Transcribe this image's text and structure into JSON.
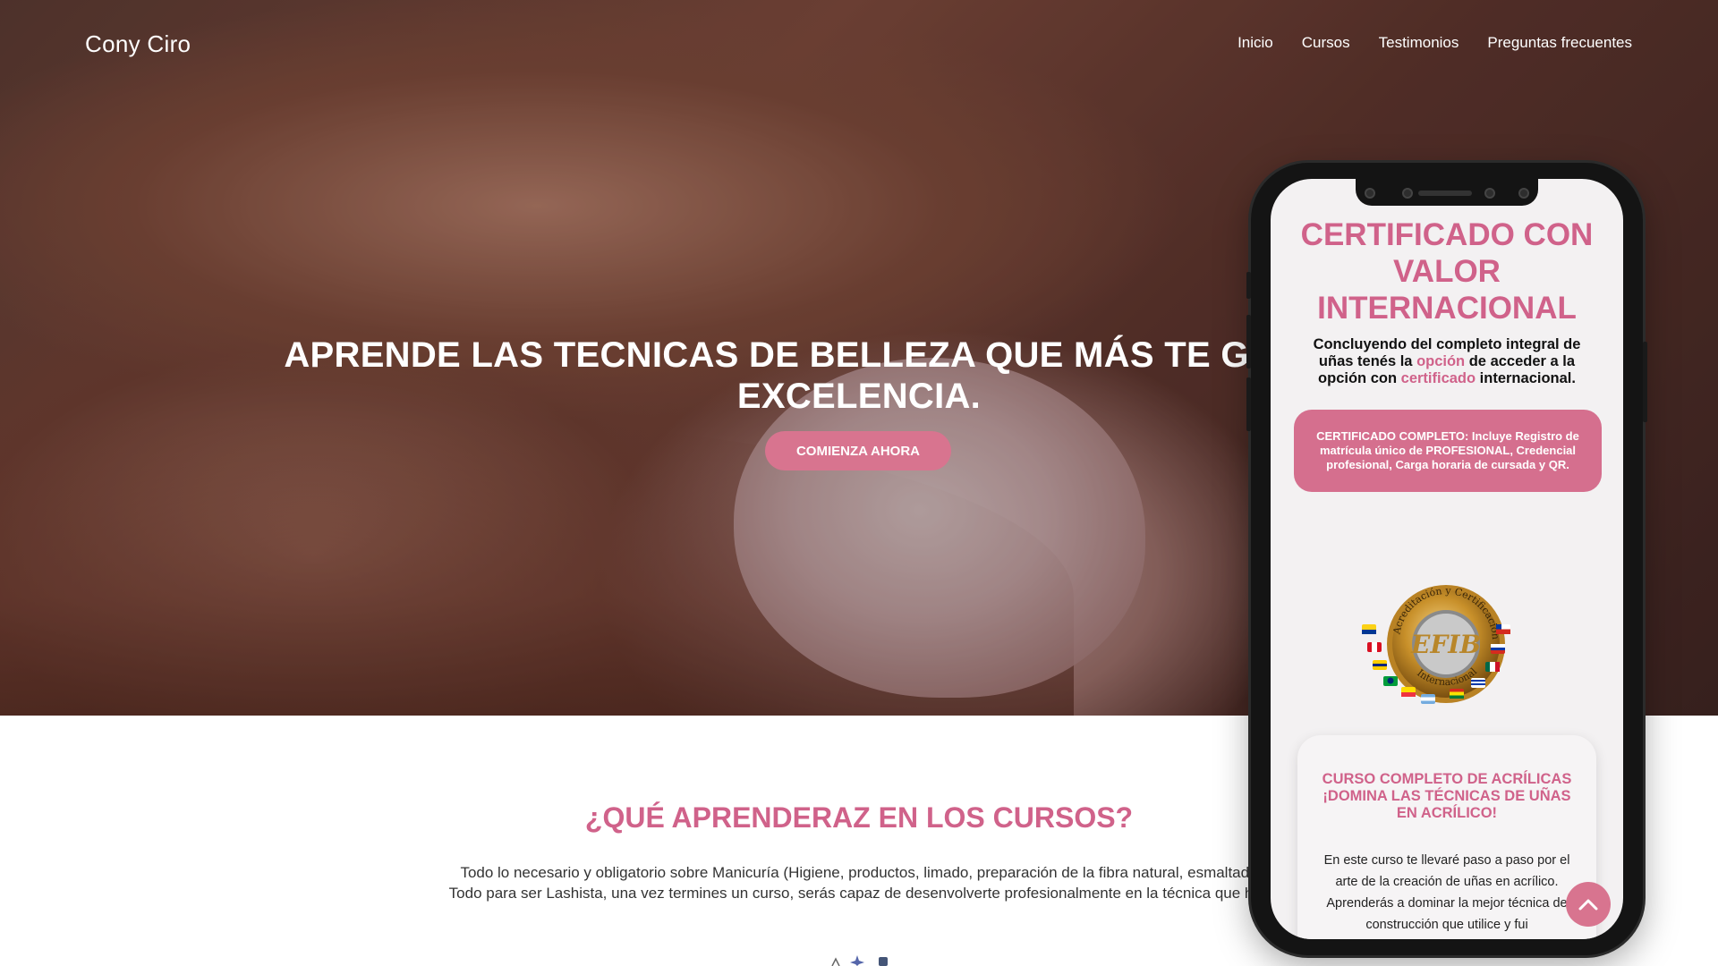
{
  "nav": {
    "brand": "Cony Ciro",
    "items": [
      "Inicio",
      "Cursos",
      "Testimonios",
      "Preguntas frecuentes"
    ]
  },
  "hero": {
    "title": "APRENDE LAS TECNICAS DE BELLEZA QUE MÁS TE GUSTEN HA EXCELENCIA.",
    "cta": "COMIENZA AHORA"
  },
  "section": {
    "title": "¿QUÉ APRENDERAZ EN LOS CURSOS?",
    "line1": "Todo lo necesario y obligatorio sobre Manicuría (Higiene, productos, limado, preparación de la fibra natural, esmaltado",
    "line2": "Todo para ser Lashista, una vez termines un curso, serás capaz de desenvolverte profesionalmente en la técnica que hay"
  },
  "phone": {
    "cert_title": "CERTIFICADO CON VALOR INTERNACIONAL",
    "cert_desc_a": "Concluyendo del completo integral de uñas tenés la ",
    "cert_desc_hl1": "opción",
    "cert_desc_b": " de acceder a la opción con ",
    "cert_desc_hl2": "certificado",
    "cert_desc_c": " internacional.",
    "cert_box": "CERTIFICADO COMPLETO: Incluye Registro de matrícula único de PROFESIONAL, Credencial profesional, Carga horaria de cursada y QR.",
    "badge_top": "Acreditación y Certificación",
    "badge_center": "EFIB",
    "badge_bottom": "Internacional",
    "course_title": "CURSO COMPLETO DE ACRÍLICAS ¡DOMINA LAS TÉCNICAS DE UÑAS EN ACRÍLICO!",
    "course_text": "En este curso te llevaré paso a paso por el arte de la creación de uñas en acrílico. Aprenderás a dominar la mejor técnica de construcción que utilice y fui"
  },
  "colors": {
    "accent": "#d0628a",
    "button": "#d8748f"
  },
  "icons": {
    "scroll_top": "chevron-up-icon"
  }
}
